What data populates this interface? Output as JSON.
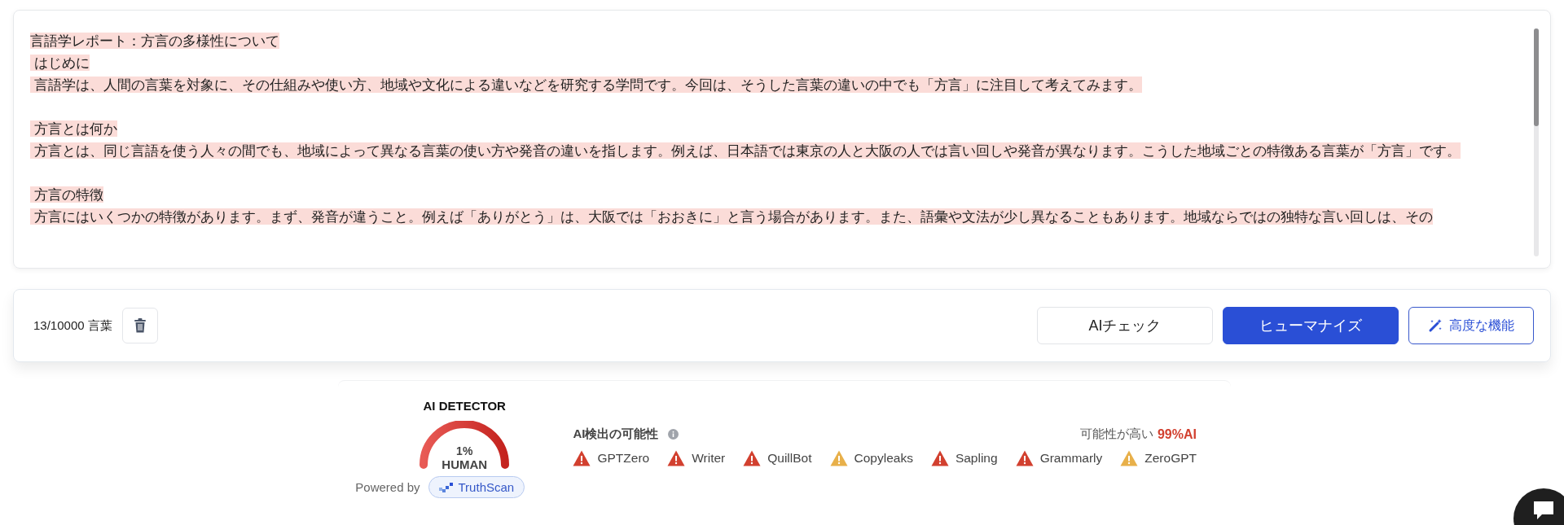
{
  "editor": {
    "title": "言語学レポート：方言の多様性について",
    "sections": [
      {
        "heading": " はじめに",
        "body": " 言語学は、人間の言葉を対象に、その仕組みや使い方、地域や文化による違いなどを研究する学問です。今回は、そうした言葉の違いの中でも「方言」に注目して考えてみます。"
      },
      {
        "heading": " 方言とは何か",
        "body": " 方言とは、同じ言語を使う人々の間でも、地域によって異なる言葉の使い方や発音の違いを指します。例えば、日本語では東京の人と大阪の人では言い回しや発音が異なります。こうした地域ごとの特徴ある言葉が「方言」です。"
      },
      {
        "heading": " 方言の特徴",
        "body": " 方言にはいくつかの特徴があります。まず、発音が違うこと。例えば「ありがとう」は、大阪では「おおきに」と言う場合があります。また、語彙や文法が少し異なることもあります。地域ならではの独特な言い回しは、その"
      }
    ]
  },
  "toolbar": {
    "word_count": "13/10000 言葉",
    "buttons": [
      {
        "kind": "plain",
        "label": "AIチェック"
      },
      {
        "kind": "primary",
        "label": "ヒューマナイズ"
      },
      {
        "kind": "outline",
        "label": "高度な機能"
      }
    ]
  },
  "detector": {
    "title": "AI DETECTOR",
    "gauge_value": "1%",
    "gauge_label": "HUMAN",
    "powered_by": "Powered by",
    "brand": "TruthScan",
    "likelihood_label": "AI検出の可能性",
    "verdict": "可能性が高い",
    "verdict_score": "99%AI",
    "tools": [
      {
        "name": "GPTZero",
        "color": "#d2402f"
      },
      {
        "name": "Writer",
        "color": "#d2402f"
      },
      {
        "name": "QuillBot",
        "color": "#d2402f"
      },
      {
        "name": "Copyleaks",
        "color": "#e8b04a"
      },
      {
        "name": "Sapling",
        "color": "#d2402f"
      },
      {
        "name": "Grammarly",
        "color": "#d2402f"
      },
      {
        "name": "ZeroGPT",
        "color": "#e8b04a"
      }
    ]
  }
}
